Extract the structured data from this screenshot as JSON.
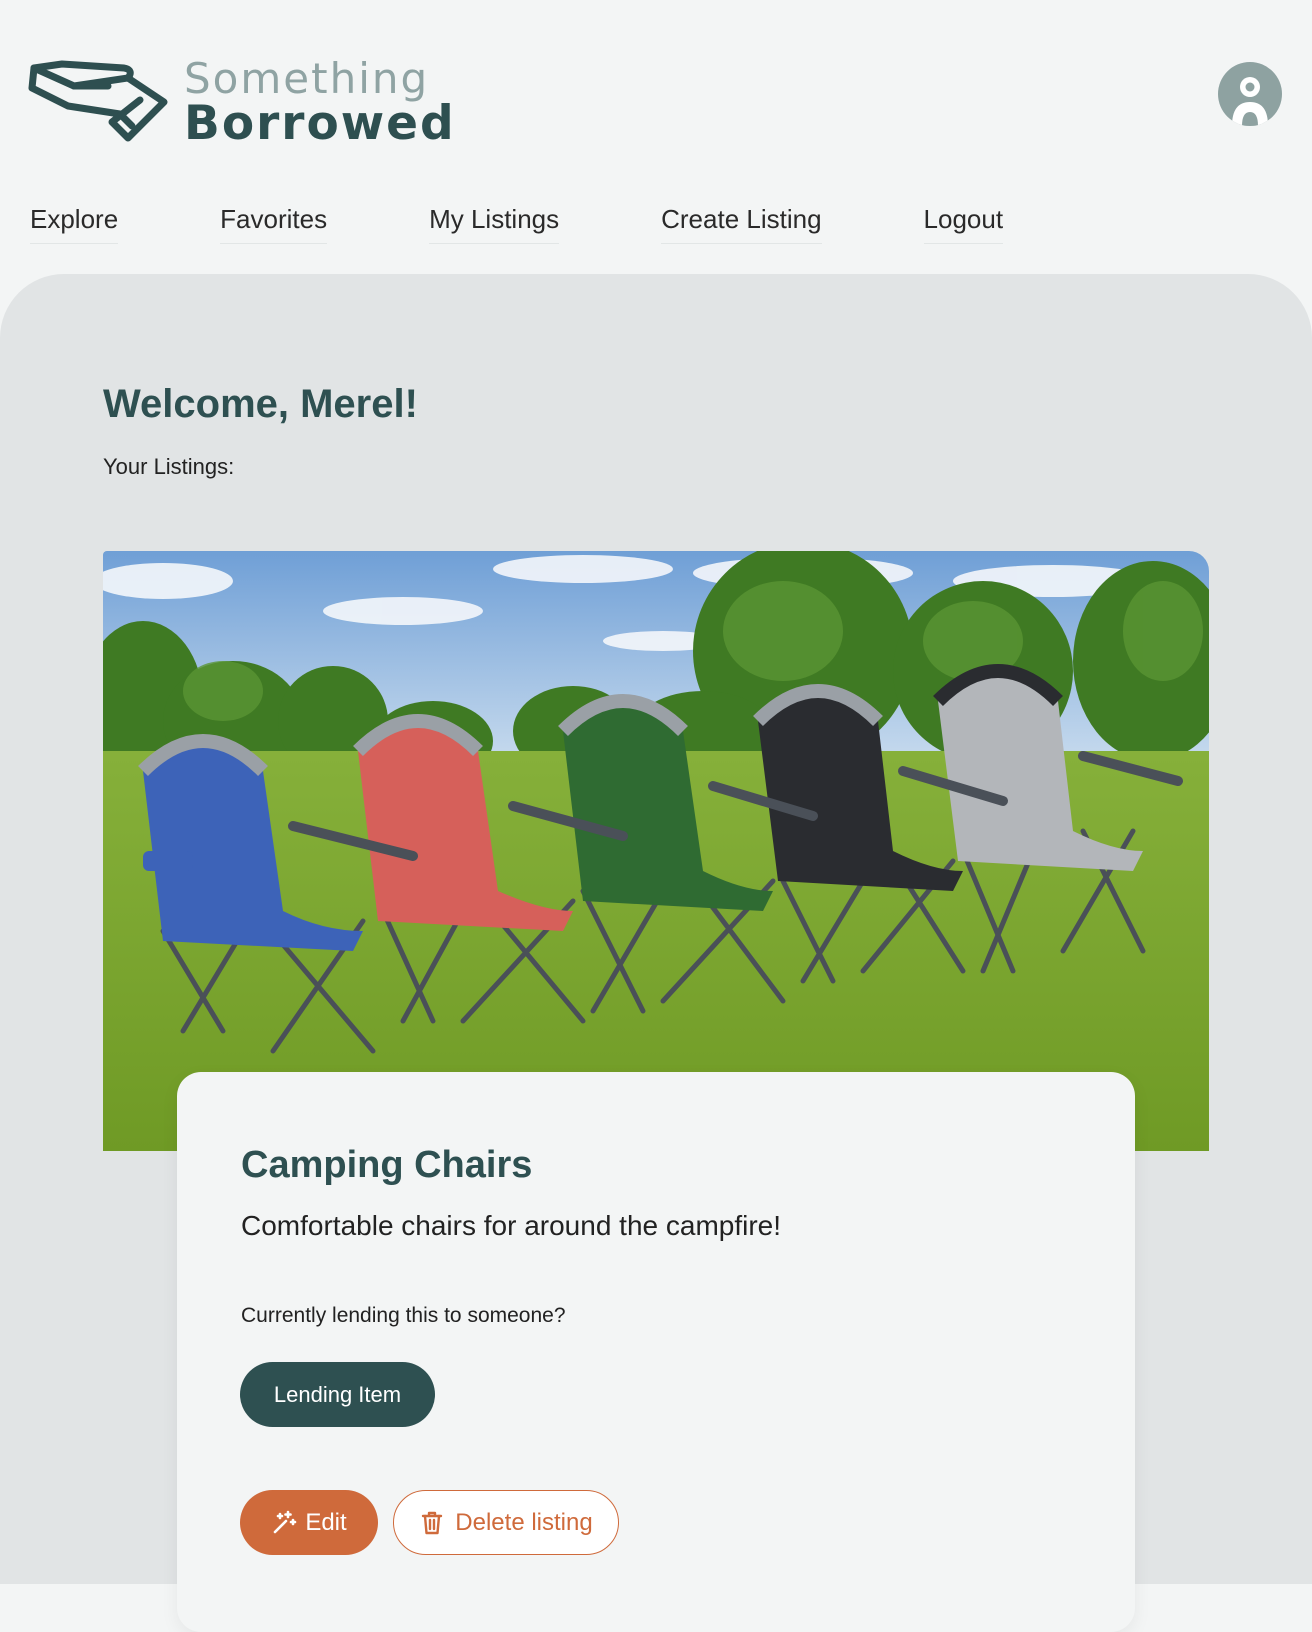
{
  "brand": {
    "line1": "Something",
    "line2": "Borrowed",
    "logo_icon": "hand-icon"
  },
  "header": {
    "avatar_icon": "user-avatar-icon"
  },
  "nav": {
    "items": [
      {
        "label": "Explore"
      },
      {
        "label": "Favorites"
      },
      {
        "label": "My Listings"
      },
      {
        "label": "Create Listing"
      },
      {
        "label": "Logout"
      }
    ]
  },
  "main": {
    "welcome": "Welcome, Merel!",
    "your_listings_label": "Your Listings:"
  },
  "listing": {
    "image_alt": "Camping Chairs",
    "title": "Camping Chairs",
    "description": "Comfortable chairs for around the campfire!",
    "lending_question": "Currently lending this to someone?",
    "lending_button": "Lending Item",
    "edit_button": "Edit",
    "edit_icon": "magic-wand-icon",
    "delete_button": "Delete listing",
    "delete_icon": "trash-icon"
  },
  "colors": {
    "brand_dark": "#2e5051",
    "brand_light": "#8fa3a3",
    "accent": "#cf6a3b",
    "panel_bg": "#e1e4e5",
    "page_bg": "#f3f5f5"
  }
}
